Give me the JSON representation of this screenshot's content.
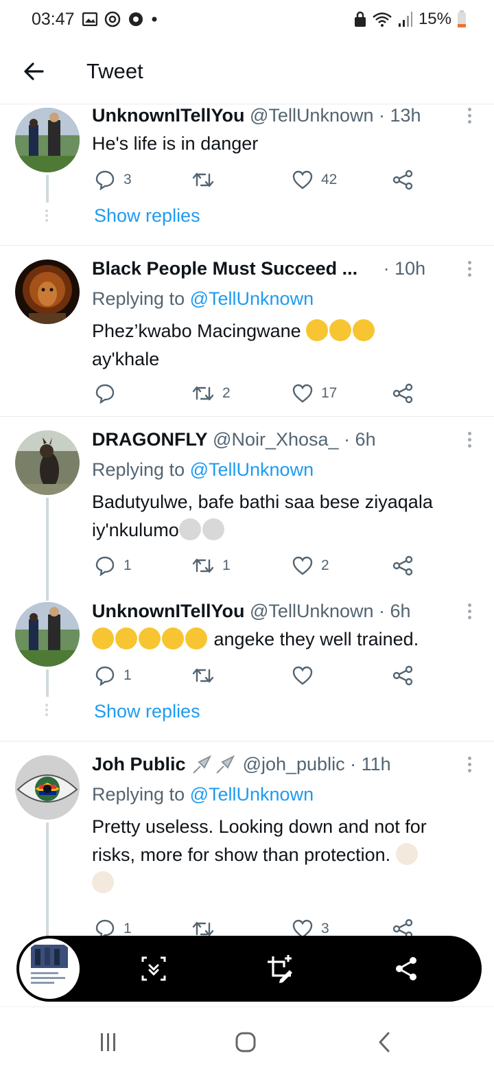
{
  "status_bar": {
    "time": "03:47",
    "battery": "15%",
    "icons_left": [
      "gallery-icon",
      "instagram-icon",
      "chrome-icon",
      "dot-icon"
    ],
    "icons_right": [
      "vpn-lock-icon",
      "wifi-icon",
      "signal-icon",
      "battery-icon"
    ]
  },
  "header": {
    "back_icon": "arrow-left-icon",
    "title": "Tweet"
  },
  "tweets": [
    {
      "name": "UnknownITellYou",
      "handle": "@TellUnknown",
      "time": "· 13h",
      "text": "He's life is in danger",
      "replies": "3",
      "retweets": "",
      "likes": "42",
      "show_replies": "Show replies"
    },
    {
      "name": "Black People Must Succeed ...",
      "handle": "",
      "time": "· 10h",
      "replying_prefix": "Replying to",
      "replying_to": "@TellUnknown",
      "text_line1": "Phez’kwabo Macingwane",
      "text_line2": "ay'khale",
      "replies": "",
      "retweets": "2",
      "likes": "17"
    },
    {
      "name": "DRAGONFLY",
      "handle": "@Noir_Xhosa_",
      "time": "· 6h",
      "replying_prefix": "Replying to",
      "replying_to": "@TellUnknown",
      "text_line1": "Badutyulwe, bafe bathi saa bese ziyaqala",
      "text_line2": "iy'nkulumo",
      "replies": "1",
      "retweets": "1",
      "likes": "2"
    },
    {
      "name": "UnknownITellYou",
      "handle": "@TellUnknown",
      "time": "· 6h",
      "text": "angeke they well trained.",
      "replies": "1",
      "retweets": "",
      "likes": "",
      "show_replies": "Show replies"
    },
    {
      "name": "Joh Public",
      "handle": "@joh_public",
      "time": "· 11h",
      "replying_prefix": "Replying to",
      "replying_to": "@TellUnknown",
      "text_line1": "Pretty useless. Looking down and not for",
      "text_line2": "risks, more for show than protection.",
      "replies": "1",
      "retweets": "",
      "likes": "3"
    }
  ],
  "screenshot_toolbar": {
    "buttons": [
      "scroll-capture-icon",
      "crop-edit-icon",
      "share-icon"
    ]
  },
  "nav_bar": {
    "buttons": [
      "recents-icon",
      "home-icon",
      "back-icon"
    ]
  },
  "colors": {
    "link": "#1d9bf0",
    "secondary_text": "#536471",
    "divider": "#e6ecf0"
  }
}
